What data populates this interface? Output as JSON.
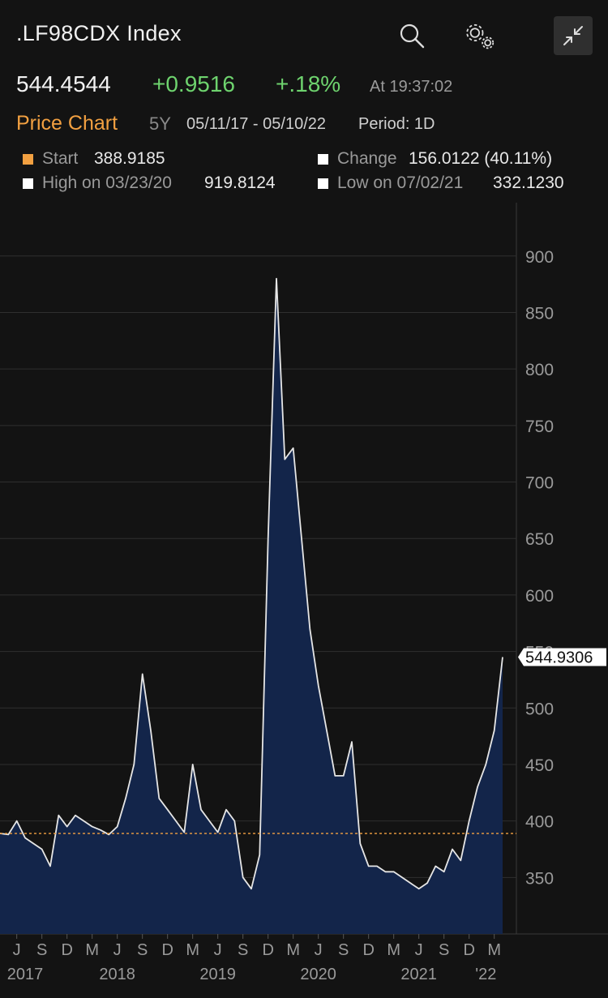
{
  "header": {
    "title": ".LF98CDX Index",
    "icons": [
      "search-icon",
      "gear-icon",
      "collapse-icon"
    ]
  },
  "quote": {
    "last": "544.4544",
    "change": "+0.9516",
    "change_pct": "+.18%",
    "time": "At 19:37:02"
  },
  "chart_bar": {
    "label": "Price Chart",
    "range": "5Y",
    "dates": "05/11/17 - 05/10/22",
    "period": "Period: 1D"
  },
  "stats": {
    "start_label": "Start",
    "start_value": "388.9185",
    "change_label": "Change",
    "change_value": "156.0122 (40.11%)",
    "high_label": "High on 03/23/20",
    "high_value": "919.8124",
    "low_label": "Low on 07/02/21",
    "low_value": "332.1230"
  },
  "colors": {
    "background": "#131313",
    "up": "#6ed36e",
    "accent": "#f2a041",
    "area_fill": "#13254a",
    "line": "#e6e6e6"
  },
  "chart_data": {
    "type": "area",
    "ylim": [
      300,
      940
    ],
    "yticks": [
      350,
      400,
      450,
      500,
      550,
      600,
      650,
      700,
      750,
      800,
      850,
      900
    ],
    "grid": true,
    "reference_line": 388.9185,
    "last_value_label": "544.9306",
    "x_month_labels": [
      "J",
      "S",
      "D",
      "M",
      "J",
      "S",
      "D",
      "M",
      "J",
      "S",
      "D",
      "M",
      "J",
      "S",
      "D",
      "M",
      "J",
      "S",
      "D",
      "M"
    ],
    "x_year_labels": [
      "2017",
      "2018",
      "2019",
      "2020",
      "2021",
      "'22"
    ],
    "x": [
      "2017-05",
      "2017-06",
      "2017-07",
      "2017-08",
      "2017-09",
      "2017-10",
      "2017-11",
      "2017-12",
      "2018-01",
      "2018-02",
      "2018-03",
      "2018-04",
      "2018-05",
      "2018-06",
      "2018-07",
      "2018-08",
      "2018-09",
      "2018-10",
      "2018-11",
      "2018-12",
      "2019-01",
      "2019-02",
      "2019-03",
      "2019-04",
      "2019-05",
      "2019-06",
      "2019-07",
      "2019-08",
      "2019-09",
      "2019-10",
      "2019-11",
      "2019-12",
      "2020-01",
      "2020-02",
      "2020-03",
      "2020-04",
      "2020-05",
      "2020-06",
      "2020-07",
      "2020-08",
      "2020-09",
      "2020-10",
      "2020-11",
      "2020-12",
      "2021-01",
      "2021-02",
      "2021-03",
      "2021-04",
      "2021-05",
      "2021-06",
      "2021-07",
      "2021-08",
      "2021-09",
      "2021-10",
      "2021-11",
      "2021-12",
      "2022-01",
      "2022-02",
      "2022-03",
      "2022-04",
      "2022-05"
    ],
    "series": [
      {
        "values": [
          389,
          388,
          400,
          385,
          380,
          375,
          360,
          405,
          395,
          405,
          400,
          395,
          392,
          388,
          395,
          420,
          450,
          530,
          480,
          420,
          410,
          400,
          390,
          450,
          410,
          400,
          390,
          410,
          400,
          350,
          340,
          370,
          650,
          880,
          720,
          730,
          650,
          570,
          520,
          480,
          440,
          440,
          470,
          380,
          360,
          360,
          355,
          355,
          350,
          345,
          340,
          345,
          360,
          355,
          375,
          365,
          400,
          430,
          450,
          480,
          545
        ]
      }
    ]
  }
}
